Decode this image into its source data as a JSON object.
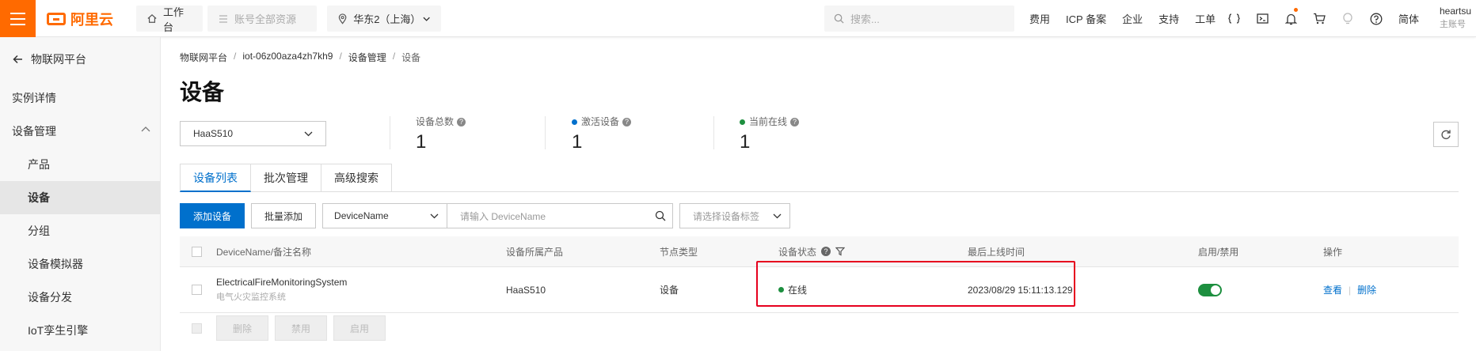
{
  "topbar": {
    "logo_text": "阿里云",
    "workbench": "工作台",
    "resource_scope": "账号全部资源",
    "region": "华东2（上海）",
    "search_placeholder": "搜索...",
    "links": [
      "费用",
      "ICP 备案",
      "企业",
      "支持",
      "工单"
    ],
    "lang": "简体",
    "user_name": "heartsu",
    "user_sub": "主账号",
    "accent_color": "#ff6a00"
  },
  "sidebar": {
    "back_title": "物联网平台",
    "items": [
      {
        "label": "实例详情"
      },
      {
        "label": "设备管理"
      },
      {
        "label": "产品"
      },
      {
        "label": "设备"
      },
      {
        "label": "分组"
      },
      {
        "label": "设备模拟器"
      },
      {
        "label": "设备分发"
      },
      {
        "label": "IoT孪生引擎"
      }
    ]
  },
  "breadcrumb": [
    "物联网平台",
    "iot-06z00aza4zh7kh9",
    "设备管理",
    "设备"
  ],
  "page": {
    "title": "设备",
    "product_selected": "HaaS510"
  },
  "stats": [
    {
      "label": "设备总数",
      "value": "1"
    },
    {
      "label": "激活设备",
      "value": "1",
      "dot_color": "#0070cc"
    },
    {
      "label": "当前在线",
      "value": "1",
      "dot_color": "#1d8f3f"
    }
  ],
  "tabs": [
    "设备列表",
    "批次管理",
    "高级搜索"
  ],
  "toolbar": {
    "add_device": "添加设备",
    "batch_add": "批量添加",
    "filter_field": "DeviceName",
    "filter_placeholder": "请输入 DeviceName",
    "tag_placeholder": "请选择设备标签"
  },
  "table": {
    "headers": [
      "DeviceName/备注名称",
      "设备所属产品",
      "节点类型",
      "设备状态",
      "最后上线时间",
      "启用/禁用",
      "操作"
    ],
    "rows": [
      {
        "name": "ElectricalFireMonitoringSystem",
        "note": "电气火灾监控系统",
        "product": "HaaS510",
        "node_type": "设备",
        "status": "在线",
        "last_online": "2023/08/29 15:11:13.129",
        "enabled": true,
        "action_view": "查看",
        "action_delete": "删除"
      }
    ]
  },
  "batch_actions": [
    "删除",
    "禁用",
    "启用"
  ],
  "colors": {
    "primary": "#0070cc",
    "online": "#1d8f3f",
    "highlight": "#e6001e"
  }
}
